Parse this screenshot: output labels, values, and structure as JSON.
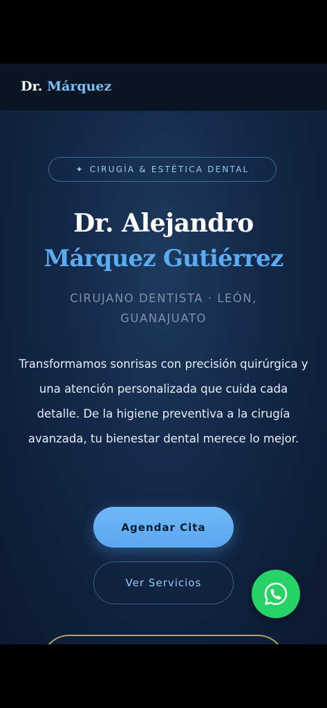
{
  "brand": {
    "name_prefix": "Dr.",
    "name_accent": "Márquez"
  },
  "hero": {
    "badge_icon": "sparkle-icon",
    "badge_text": "CIRUGÍA & ESTÉTICA DENTAL",
    "name_line1": "Dr. Alejandro",
    "name_line2": "Márquez Gutiérrez",
    "subtitle": "CIRUJANO DENTISTA · LEÓN, GUANAJUATO",
    "description": "Transformamos sonrisas con precisión quirúrgica y una atención personalizada que cuida cada detalle. De la higiene preventiva a la cirugía avanzada, tu bienestar dental merece lo mejor.",
    "primary_button": "Agendar Cita",
    "secondary_button": "Ver Servicios"
  },
  "floating": {
    "whatsapp_icon": "whatsapp-icon"
  },
  "colors": {
    "accent_blue": "#5aabf2",
    "badge_text": "#9ac9f3",
    "gold_border": "#b5a36a",
    "whatsapp_green": "#25d366"
  }
}
